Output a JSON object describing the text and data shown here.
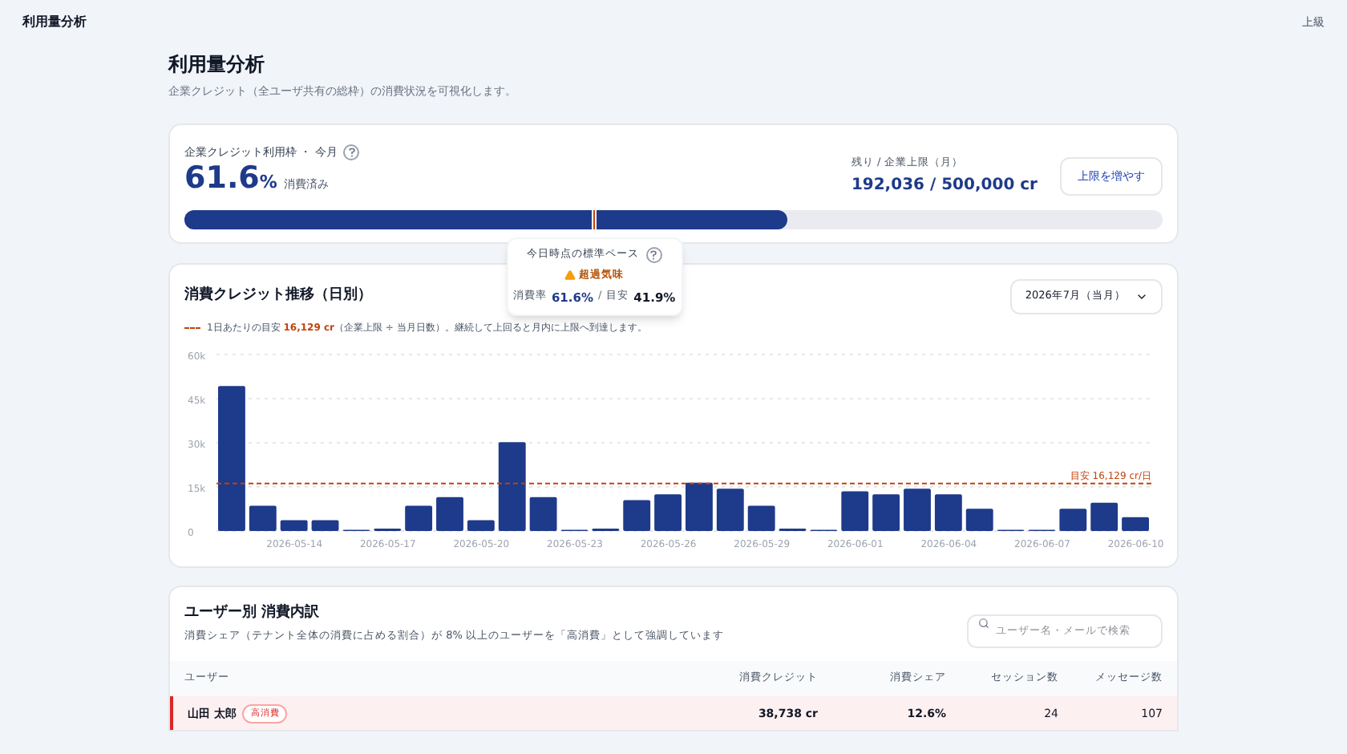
{
  "topbar": {
    "title": "利用量分析",
    "user": "上級"
  },
  "page": {
    "title": "利用量分析",
    "subtitle": "企業クレジット（全ユーザ共有の総枠）の消費状況を可視化します。"
  },
  "quota": {
    "label": "企業クレジット利用枠 ・ 今月",
    "percent": "61.6",
    "percent_unit": "%",
    "percent_caption": "消費済み",
    "remaining_label": "残り / 企業上限（月）",
    "remaining": "192,036 / 500,000 cr",
    "button": "上限を増やす",
    "level": 0.616,
    "pace_tooltip": {
      "title": "今日時点の標準ペース",
      "warning": "超過気味",
      "rate_label": "消費率",
      "rate": "61.6%",
      "separator": "/",
      "target_label": "目安",
      "target": "41.9%"
    }
  },
  "trend": {
    "title": "消費クレジット推移（日別）",
    "period": "2026年7月（当月）",
    "legend_prefix": "1日あたりの目安",
    "legend_value": "16,129 cr",
    "legend_suffix": "（企業上限 ÷ 当月日数）。継続して上回ると月内に上限へ到達します。",
    "chart_data": {
      "type": "bar",
      "grid": true,
      "categories": [
        null,
        null,
        "2026-05-14",
        null,
        null,
        "2026-05-17",
        null,
        null,
        "2026-05-20",
        null,
        null,
        "2026-05-23",
        null,
        null,
        "2026-05-26",
        null,
        null,
        "2026-05-29",
        null,
        null,
        "2026-06-01",
        null,
        null,
        "2026-06-04",
        null,
        null,
        "2026-06-07",
        null,
        null,
        "2026-06-10"
      ],
      "values": [
        49300,
        8600,
        3700,
        3700,
        400,
        800,
        8600,
        11500,
        3700,
        30200,
        11500,
        400,
        800,
        10500,
        12500,
        16400,
        14400,
        8600,
        800,
        400,
        13500,
        12500,
        14400,
        12500,
        7600,
        400,
        400,
        7600,
        9600,
        4700
      ],
      "ylim": [
        0,
        60000
      ],
      "yticks": [
        {
          "value": 0,
          "label": "0"
        },
        {
          "value": 15000,
          "label": "15k"
        },
        {
          "value": 30000,
          "label": "30k"
        },
        {
          "value": 45000,
          "label": "45k"
        },
        {
          "value": 60000,
          "label": "60k"
        }
      ],
      "ref_lines": [
        {
          "axis": "y",
          "value": 16129,
          "label": "目安 16,129 cr/日"
        }
      ]
    }
  },
  "users": {
    "title": "ユーザー別 消費内訳",
    "subtitle": "消費シェア（テナント全体の消費に占める割合）が 8% 以上のユーザーを「高消費」として強調しています",
    "search_placeholder": "ユーザー名・メールで検索",
    "columns": [
      "ユーザー",
      "消費クレジット",
      "消費シェア",
      "セッション数",
      "メッセージ数"
    ],
    "rows": [
      {
        "name": "山田 太郎",
        "high": true,
        "badge": "高消費",
        "credits": "38,738 cr",
        "share": "12.6%",
        "sessions": "24",
        "messages": "107"
      }
    ]
  }
}
